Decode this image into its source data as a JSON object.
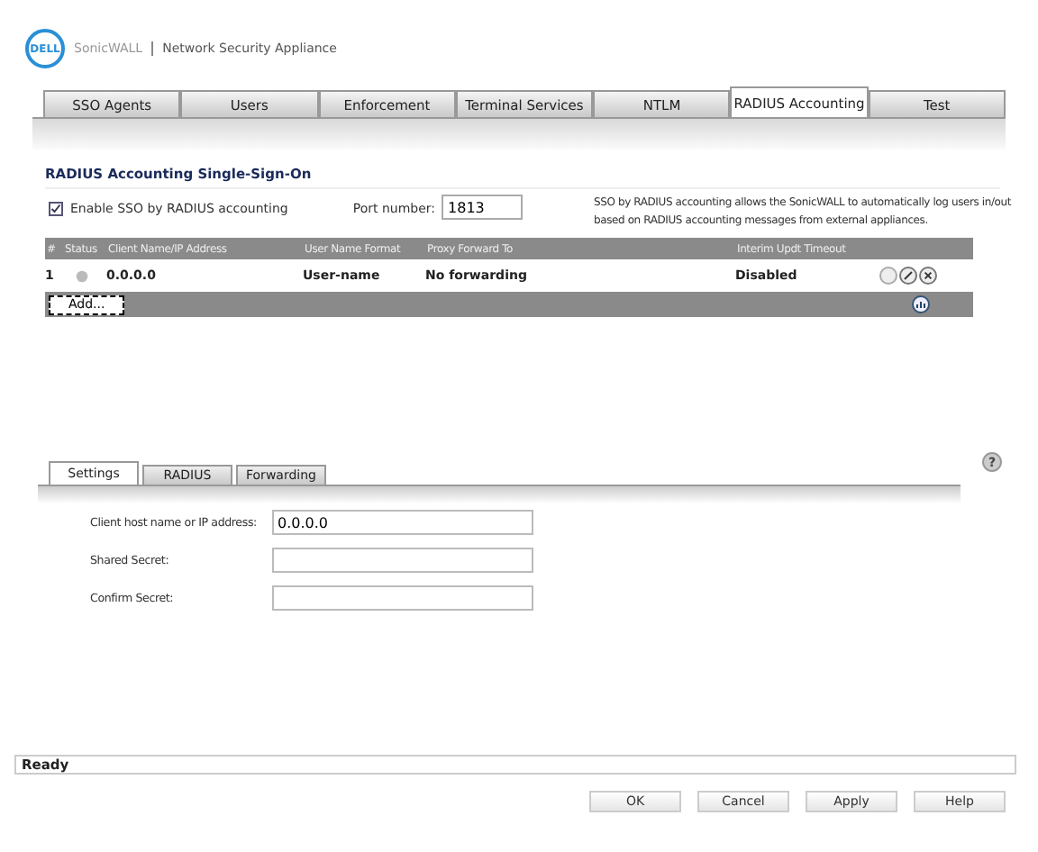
{
  "header": {
    "logo": "DELL",
    "brand": "SonicWALL",
    "product": "Network Security Appliance"
  },
  "tabs": [
    {
      "label": "SSO Agents",
      "selected": false
    },
    {
      "label": "Users",
      "selected": false
    },
    {
      "label": "Enforcement",
      "selected": false
    },
    {
      "label": "Terminal Services",
      "selected": false
    },
    {
      "label": "NTLM",
      "selected": false
    },
    {
      "label": "RADIUS Accounting",
      "selected": true
    },
    {
      "label": "Test",
      "selected": false
    }
  ],
  "section_title": "RADIUS Accounting Single-Sign-On",
  "enable": {
    "label": "Enable SSO by RADIUS accounting",
    "checked": true
  },
  "port": {
    "label": "Port number:",
    "value": "1813"
  },
  "description": "SSO by RADIUS accounting allows the SonicWALL to automatically log users in/out based on RADIUS accounting messages from external appliances.",
  "table": {
    "columns": [
      "#",
      "Status",
      "Client Name/IP Address",
      "User Name Format",
      "Proxy Forward To",
      "Interim Updt Timeout"
    ],
    "rows": [
      {
        "cells": [
          "1",
          null,
          "0.0.0.0",
          "User-name",
          "No forwarding",
          "Disabled"
        ]
      }
    ],
    "add_button": "Add..."
  },
  "sub_tabs": [
    {
      "label": "Settings",
      "selected": true
    },
    {
      "label": "RADIUS",
      "selected": false
    },
    {
      "label": "Forwarding",
      "selected": false
    }
  ],
  "help": "?",
  "fields": [
    {
      "label": "Client host name or IP address:",
      "value": "0.0.0.0"
    },
    {
      "label": "Shared Secret:"
    },
    {
      "label": "Confirm Secret:"
    }
  ],
  "status_bar": "Ready",
  "buttons": [
    "OK",
    "Cancel",
    "Apply",
    "Help"
  ]
}
